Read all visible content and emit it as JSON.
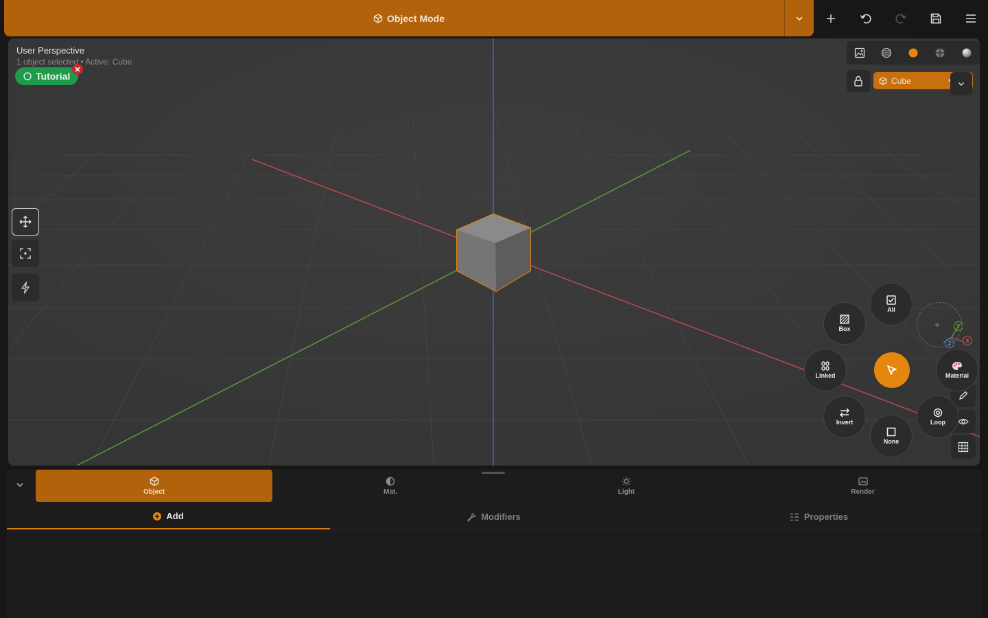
{
  "topbar": {
    "mode_label": "Object Mode",
    "actions": [
      "plus-icon",
      "undo-icon",
      "redo-icon",
      "save-icon",
      "menu-icon"
    ]
  },
  "viewport": {
    "title": "User Perspective",
    "subtitle": "1 object selected • Active: Cube",
    "tutorial_label": "Tutorial",
    "left_tools": [
      "move-icon",
      "frame-select-icon",
      "lightning-icon"
    ],
    "shading_modes": [
      "image-icon",
      "wireframe-shading-icon",
      "material-preview-icon",
      "solid-shading-icon",
      "rendered-shading-icon"
    ],
    "active_object": "Cube"
  },
  "pie_menu": {
    "all": "All",
    "box": "Box",
    "linked": "Linked",
    "material": "Material",
    "invert": "Invert",
    "none": "None",
    "loop": "Loop"
  },
  "gizmo": {
    "y": "Y",
    "z": "Z",
    "x": "X"
  },
  "colors": {
    "accent": "#b2620a",
    "accent_bright": "#e5870f",
    "tutorial": "#1f9a4b",
    "axis_x": "#b84a4f",
    "axis_y": "#5b9a3c",
    "axis_z": "#4f73c8"
  },
  "panel": {
    "tabs": [
      {
        "label": "Object",
        "icon": "cube-icon"
      },
      {
        "label": "Mat.",
        "icon": "material-icon"
      },
      {
        "label": "Light",
        "icon": "light-icon"
      },
      {
        "label": "Render",
        "icon": "render-icon"
      }
    ],
    "subtabs": [
      {
        "label": "Add",
        "icon": "add-icon"
      },
      {
        "label": "Modifiers",
        "icon": "wrench-icon"
      },
      {
        "label": "Properties",
        "icon": "properties-icon"
      }
    ]
  }
}
